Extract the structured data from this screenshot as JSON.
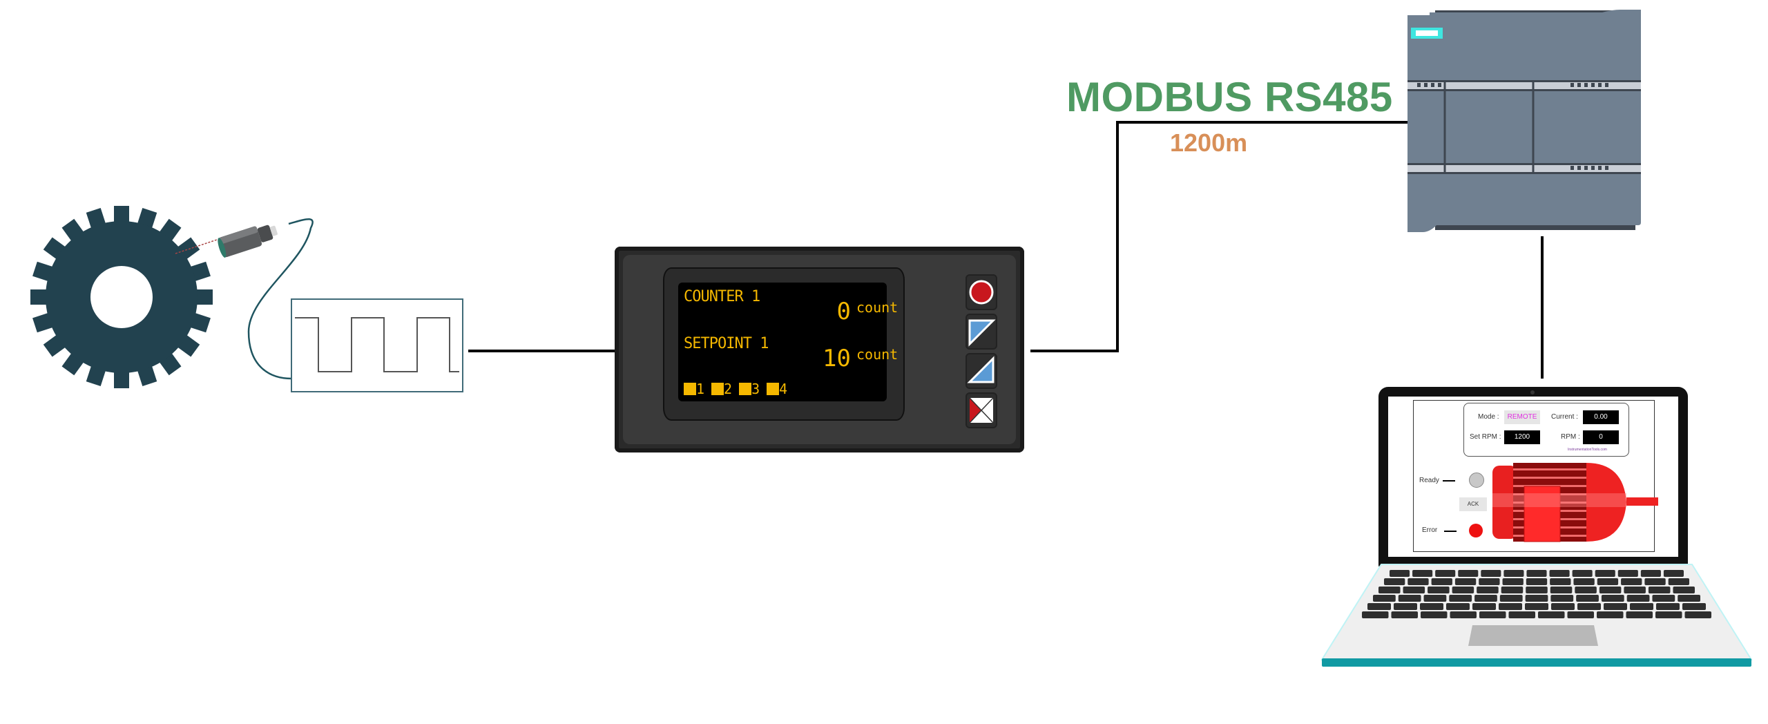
{
  "diagram": {
    "title": "MODBUS RS485",
    "distance_label": "1200m",
    "colors": {
      "title": "#4f9a62",
      "distance": "#d88f58",
      "gear": "#22424f",
      "lcd_text": "#f5b800",
      "plc_body": "#708091",
      "laptop_base": "#119aa3"
    },
    "components": [
      {
        "id": "gear",
        "label": "gear-wheel"
      },
      {
        "id": "sensor",
        "label": "proximity-sensor"
      },
      {
        "id": "pulse",
        "label": "pulse-signal"
      },
      {
        "id": "counter",
        "label": "digital-counter"
      },
      {
        "id": "plc",
        "label": "plc"
      },
      {
        "id": "laptop",
        "label": "hmi-laptop"
      }
    ]
  },
  "counter": {
    "row1_label": "COUNTER 1",
    "row1_value": "0",
    "row1_unit": "count",
    "row2_label": "SETPOINT 1",
    "row2_value": "10",
    "row2_unit": "count",
    "indicators": [
      "1",
      "2",
      "3",
      "4"
    ],
    "buttons": [
      "record-button",
      "down-button",
      "up-button",
      "cancel-button"
    ]
  },
  "hmi": {
    "mode_label": "Mode :",
    "mode_value": "REMOTE",
    "current_label": "Current :",
    "current_value": "0.00",
    "set_rpm_label": "Set RPM :",
    "set_rpm_value": "1200",
    "rpm_label": "RPM :",
    "rpm_value": "0",
    "watermark": "InstrumentationTools.com",
    "ready_label": "Ready",
    "ack_label": "ACK",
    "error_label": "Error"
  }
}
